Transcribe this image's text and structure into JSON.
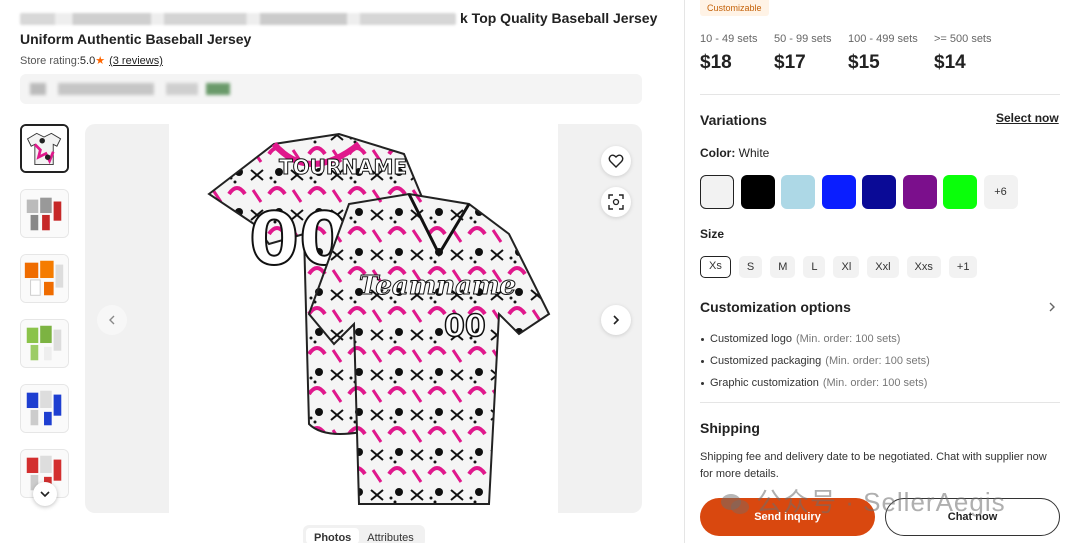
{
  "header": {
    "title_visible": "k Top Quality Baseball Jersey",
    "title_line2": "Uniform Authentic Baseball Jersey",
    "store_rating_label": "Store rating:",
    "store_rating_value": "5.0",
    "reviews_link": "(3 reviews)"
  },
  "gallery": {
    "tabs": [
      "Photos",
      "Attributes"
    ],
    "active_tab": "Photos",
    "jersey_name_text": "Teamname",
    "jersey_number": "00",
    "jersey_top_text": "TOURNAME"
  },
  "product": {
    "badge": "Customizable",
    "tiers": [
      {
        "qty": "10 - 49 sets",
        "price": "$18"
      },
      {
        "qty": "50 - 99 sets",
        "price": "$17"
      },
      {
        "qty": "100 - 499 sets",
        "price": "$15"
      },
      {
        "qty": ">= 500 sets",
        "price": "$14"
      }
    ],
    "variations_title": "Variations",
    "select_now": "Select now",
    "color_label": "Color:",
    "color_value": "White",
    "colors": [
      {
        "name": "White",
        "hex": "#f2f2f2",
        "selected": true
      },
      {
        "name": "Black",
        "hex": "#000000"
      },
      {
        "name": "Light Blue",
        "hex": "#add8e6"
      },
      {
        "name": "Blue",
        "hex": "#0a1eff"
      },
      {
        "name": "Navy",
        "hex": "#0a0a96"
      },
      {
        "name": "Purple",
        "hex": "#7b0f8c"
      },
      {
        "name": "Green",
        "hex": "#0aff0a"
      }
    ],
    "colors_more": "+6",
    "size_label": "Size",
    "sizes": [
      "Xs",
      "S",
      "M",
      "L",
      "Xl",
      "Xxl",
      "Xxs"
    ],
    "sizes_more": "+1",
    "selected_size": "Xs",
    "customization_title": "Customization options",
    "customization": [
      {
        "name": "Customized logo",
        "min": "(Min. order: 100 sets)"
      },
      {
        "name": "Customized packaging",
        "min": "(Min. order: 100 sets)"
      },
      {
        "name": "Graphic customization",
        "min": "(Min. order: 100 sets)"
      }
    ],
    "shipping_title": "Shipping",
    "shipping_text": "Shipping fee and delivery date to be negotiated. Chat with supplier now for more details.",
    "send_inquiry": "Send inquiry",
    "chat_now": "Chat now",
    "watermark": "公众号 · SellerAegis"
  },
  "colors": {
    "accent": "#d9480f",
    "star": "#ff6600",
    "badge_text": "#c4620a",
    "jersey_pink": "#e0188c"
  }
}
